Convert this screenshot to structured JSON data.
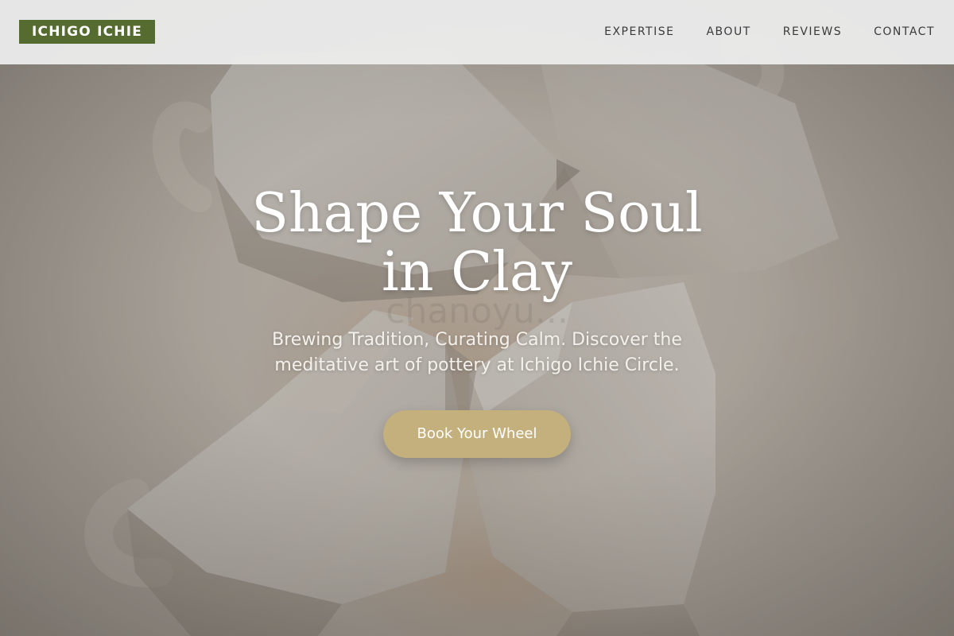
{
  "header": {
    "logo": "ICHIGO ICHIE",
    "nav": [
      {
        "label": "EXPERTISE"
      },
      {
        "label": "ABOUT"
      },
      {
        "label": "REVIEWS"
      },
      {
        "label": "CONTACT"
      }
    ]
  },
  "hero": {
    "title_line1": "Shape Your Soul",
    "title_line2": "in Clay",
    "subtitle": "Brewing Tradition, Curating Calm. Discover the meditative art of pottery at Ichigo Ichie Circle.",
    "cta_label": "Book Your Wheel",
    "watermark": "chanoyu..."
  },
  "colors": {
    "logo_bg": "#556b2f",
    "cta_bg": "#c4b07c",
    "header_bg": "#ececec"
  }
}
